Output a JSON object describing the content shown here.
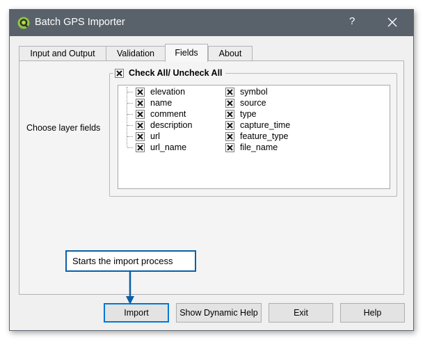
{
  "window": {
    "title": "Batch GPS Importer",
    "help_button": "?",
    "close_icon": "close-icon",
    "app_icon": "qgis-logo-icon",
    "titlebar_color": "#59626b"
  },
  "tabs": [
    {
      "label": "Input and Output",
      "active": false
    },
    {
      "label": "Validation",
      "active": false
    },
    {
      "label": "Fields",
      "active": true
    },
    {
      "label": "About",
      "active": false
    }
  ],
  "fields_tab": {
    "choose_label": "Choose layer fields",
    "check_all": {
      "label": "Check All/ Uncheck All",
      "checked": true
    },
    "fields_left": [
      {
        "label": "elevation",
        "checked": true
      },
      {
        "label": "name",
        "checked": true
      },
      {
        "label": "comment",
        "checked": true
      },
      {
        "label": "description",
        "checked": true
      },
      {
        "label": "url",
        "checked": true
      },
      {
        "label": "url_name",
        "checked": true
      }
    ],
    "fields_right": [
      {
        "label": "symbol",
        "checked": true
      },
      {
        "label": "source",
        "checked": true
      },
      {
        "label": "type",
        "checked": true
      },
      {
        "label": "capture_time",
        "checked": true
      },
      {
        "label": "feature_type",
        "checked": true
      },
      {
        "label": "file_name",
        "checked": true
      }
    ]
  },
  "buttons": {
    "import": "Import",
    "dynamic_help": "Show Dynamic Help",
    "exit": "Exit",
    "help": "Help"
  },
  "callout": {
    "text": "Starts the import process",
    "border_color": "#0a5fa8"
  }
}
